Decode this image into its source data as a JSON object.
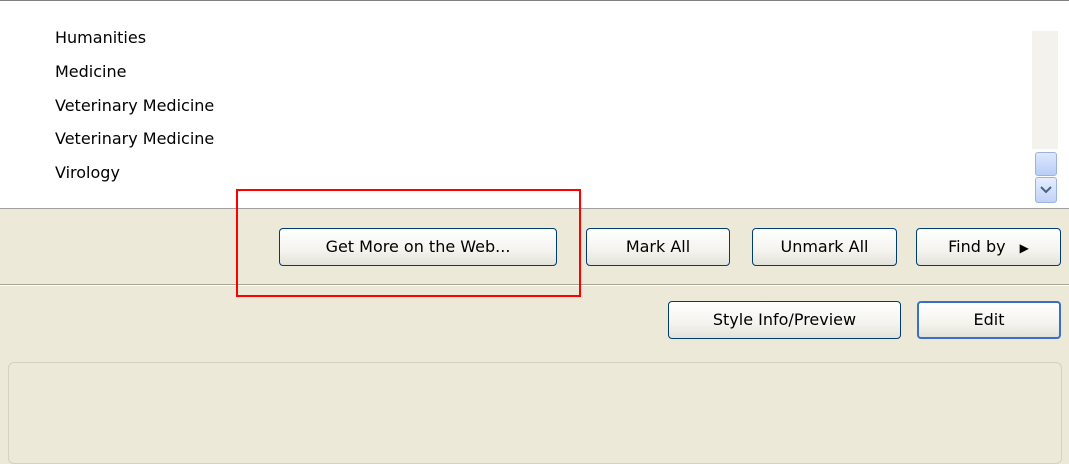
{
  "list": {
    "items": [
      {
        "label": "Humanities"
      },
      {
        "label": "Medicine"
      },
      {
        "label": "Veterinary Medicine"
      },
      {
        "label": "Veterinary Medicine"
      },
      {
        "label": "Virology"
      }
    ]
  },
  "buttons": {
    "get_more": "Get More on the Web...",
    "mark_all": "Mark All",
    "unmark_all": "Unmark All",
    "find_by": "Find by",
    "style_info": "Style Info/Preview",
    "edit": "Edit"
  },
  "colors": {
    "highlight": "#ff0000",
    "dialog_bg": "#ece9d8",
    "button_border": "#003c74"
  }
}
